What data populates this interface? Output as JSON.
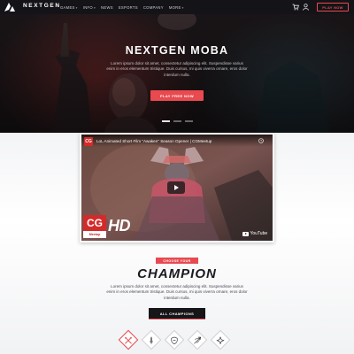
{
  "nav": {
    "brand": "NEXTGEN",
    "items": [
      {
        "label": "GAMES",
        "has_caret": true
      },
      {
        "label": "INFO",
        "has_caret": true
      },
      {
        "label": "NEWS",
        "has_caret": false
      },
      {
        "label": "ESPORTS",
        "has_caret": false
      },
      {
        "label": "COMPANY",
        "has_caret": false
      },
      {
        "label": "MORE",
        "has_caret": true
      }
    ],
    "caret": "▾",
    "play_label": "PLAY NOW",
    "icons": [
      "logo-icon",
      "cart-icon",
      "user-icon"
    ]
  },
  "hero": {
    "title": "NEXTGEN MOBA",
    "text": "Lorem ipsum dolor sit amet, consectetur adipiscing elit. Suspendisse varius enim in eros elementum tristique. Duis cursus, mi quis viverra ornare, eros dolor interdum nulla.",
    "cta": "PLAY FREE NOW",
    "slides": 3,
    "active_slide": 0
  },
  "video": {
    "channel_badge": "CG",
    "title": "LoL Animated Short Film \"Awaken\" Season Opener | CGMeetup",
    "logo_letters": "CG",
    "logo_sub": "Meetup",
    "hd_label": "HD",
    "platform": "YouTube"
  },
  "champion": {
    "eyebrow": "CHOOSE YOUR",
    "title": "CHAMPION",
    "text": "Lorem ipsum dolor sit amet, consectetur adipiscing elit. Suspendisse varius enim in eros elementum tristique. Duis cursus, mi quis viverra ornare, eros dolor interdum nulla.",
    "cta": "ALL CHAMPIONS",
    "roles": [
      "assassin-icon",
      "fighter-icon",
      "tank-icon",
      "marksman-icon",
      "mage-icon"
    ],
    "active_role": 0
  },
  "colors": {
    "accent": "#e84a4f",
    "nav_bg": "#141418",
    "dark_button": "#161619"
  }
}
